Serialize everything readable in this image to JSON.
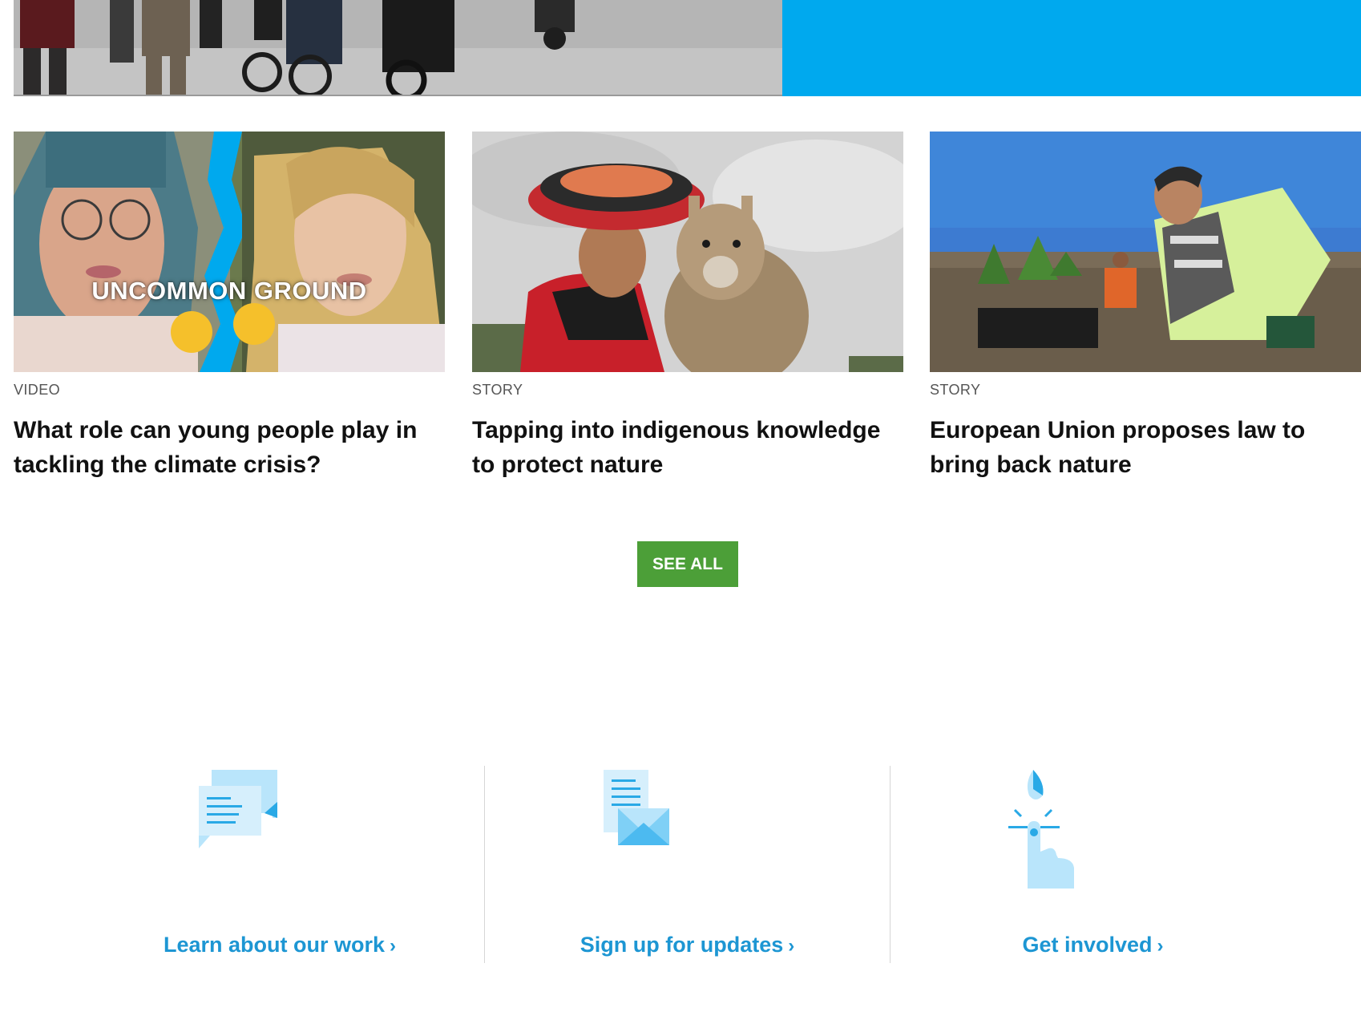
{
  "cards": [
    {
      "type": "VIDEO",
      "title": "What role can young people play in tackling the climate crisis?",
      "overlay": "UNCOMMON GROUND",
      "thumb_icon": "video-thumbnail"
    },
    {
      "type": "STORY",
      "title": "Tapping into indigenous knowledge to protect nature",
      "thumb_icon": "child-with-llama-photo"
    },
    {
      "type": "STORY",
      "title": "European Union proposes law to bring back nature",
      "thumb_icon": "tree-planting-photo"
    }
  ],
  "see_all": "SEE ALL",
  "actions": [
    {
      "label": "Learn about our work",
      "chevron": "›",
      "icon": "chat-bubbles-icon"
    },
    {
      "label": "Sign up for updates",
      "chevron": "›",
      "icon": "newsletter-envelope-icon"
    },
    {
      "label": "Get involved",
      "chevron": "›",
      "icon": "tap-hand-leaf-icon"
    }
  ],
  "colors": {
    "hero_blue": "#00a9ee",
    "see_all_green": "#4c9f38",
    "link_blue": "#1d96d3",
    "icon_light_blue": "#b9e5fb",
    "icon_blue": "#29a9e6"
  }
}
